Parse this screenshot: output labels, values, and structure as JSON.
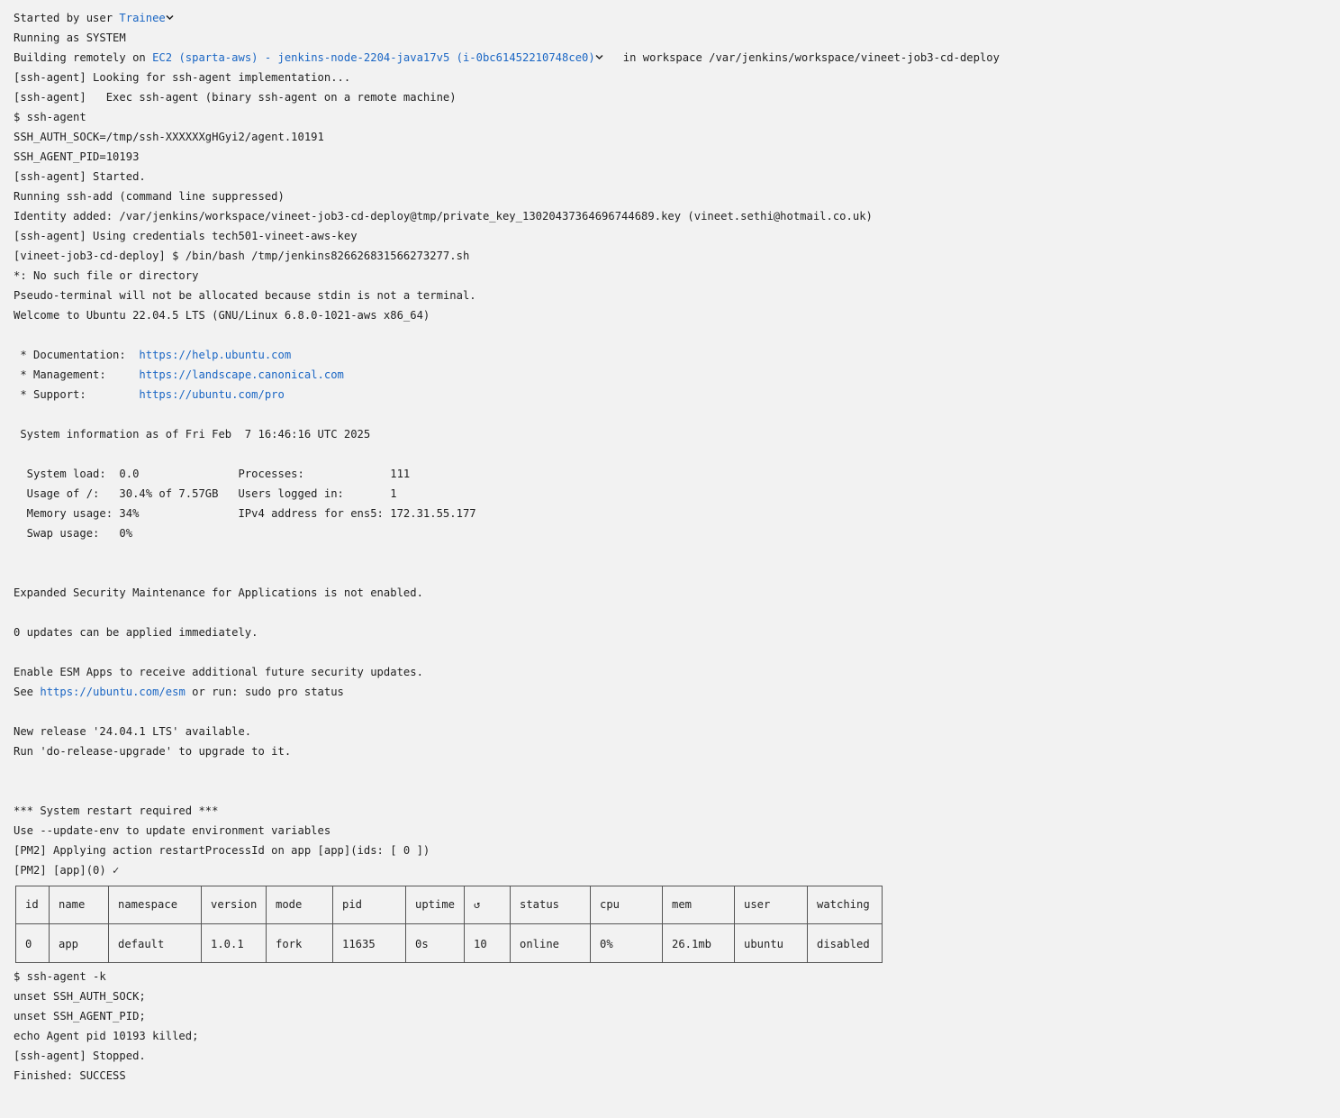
{
  "header": {
    "started_prefix": "Started by user ",
    "started_user": "Trainee",
    "running_as": "Running as SYSTEM",
    "building_prefix": "Building remotely on ",
    "building_node": "EC2 (sparta-aws) - jenkins-node-2204-java17v5 (i-0bc61452210748ce0)",
    "building_suffix": "   in workspace /var/jenkins/workspace/vineet-job3-cd-deploy"
  },
  "log_lines_a": [
    "[ssh-agent] Looking for ssh-agent implementation...",
    "[ssh-agent]   Exec ssh-agent (binary ssh-agent on a remote machine)",
    "$ ssh-agent",
    "SSH_AUTH_SOCK=/tmp/ssh-XXXXXXgHGyi2/agent.10191",
    "SSH_AGENT_PID=10193",
    "[ssh-agent] Started.",
    "Running ssh-add (command line suppressed)",
    "Identity added: /var/jenkins/workspace/vineet-job3-cd-deploy@tmp/private_key_13020437364696744689.key (vineet.sethi@hotmail.co.uk)",
    "[ssh-agent] Using credentials tech501-vineet-aws-key",
    "[vineet-job3-cd-deploy] $ /bin/bash /tmp/jenkins826626831566273277.sh",
    "*: No such file or directory",
    "Pseudo-terminal will not be allocated because stdin is not a terminal.",
    "Welcome to Ubuntu 22.04.5 LTS (GNU/Linux 6.8.0-1021-aws x86_64)"
  ],
  "motd_links": [
    {
      "label": " * Documentation:  ",
      "url": "https://help.ubuntu.com"
    },
    {
      "label": " * Management:     ",
      "url": "https://landscape.canonical.com"
    },
    {
      "label": " * Support:        ",
      "url": "https://ubuntu.com/pro"
    }
  ],
  "sysinfo_header": " System information as of Fri Feb  7 16:46:16 UTC 2025",
  "sysinfo_lines": [
    "  System load:  0.0               Processes:             111",
    "  Usage of /:   30.4% of 7.57GB   Users logged in:       1",
    "  Memory usage: 34%               IPv4 address for ens5: 172.31.55.177",
    "  Swap usage:   0%"
  ],
  "esm_line": "Expanded Security Maintenance for Applications is not enabled.",
  "updates_line": "0 updates can be applied immediately.",
  "esm_enable_line": "Enable ESM Apps to receive additional future security updates.",
  "esm_see_prefix": "See ",
  "esm_url": "https://ubuntu.com/esm",
  "esm_see_suffix": " or run: sudo pro status",
  "release_line": "New release '24.04.1 LTS' available.",
  "upgrade_line": "Run 'do-release-upgrade' to upgrade to it.",
  "restart_line": "*** System restart required ***",
  "update_env_line": "Use --update-env to update environment variables",
  "pm2_apply_line": "[PM2] Applying action restartProcessId on app [app](ids: [ 0 ])",
  "pm2_done_line": "[PM2] [app](0) ✓",
  "pm2_table": {
    "headers": [
      "id",
      "name",
      "namespace",
      "version",
      "mode",
      "pid",
      "uptime",
      "↺",
      "status",
      "cpu",
      "mem",
      "user",
      "watching"
    ],
    "rows": [
      [
        "0",
        "app",
        "default",
        "1.0.1",
        "fork",
        "11635",
        "0s",
        "10",
        "online",
        "0%",
        "26.1mb",
        "ubuntu",
        "disabled"
      ]
    ]
  },
  "log_lines_b": [
    "$ ssh-agent -k",
    "unset SSH_AUTH_SOCK;",
    "unset SSH_AGENT_PID;",
    "echo Agent pid 10193 killed;",
    "[ssh-agent] Stopped.",
    "Finished: SUCCESS"
  ],
  "colors": {
    "background": "#f2f2f2",
    "text": "#1f1f1f",
    "link": "#1a66c4"
  },
  "icons": {
    "user_menu": "chevron-down-icon",
    "node_menu": "chevron-down-icon"
  }
}
